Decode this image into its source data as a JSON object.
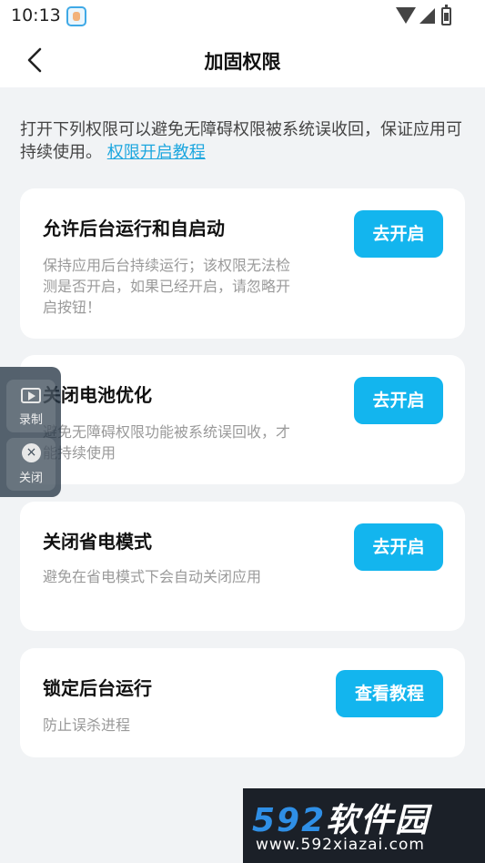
{
  "status_bar": {
    "time": "10:13",
    "icons": [
      "app-notification-icon",
      "wifi-icon",
      "signal-icon",
      "battery-icon"
    ]
  },
  "header": {
    "back_icon": "chevron-left-icon",
    "title": "加固权限"
  },
  "intro": {
    "text": "打开下列权限可以避免无障碍权限被系统误收回，保证应用可持续使用。",
    "link": "权限开启教程"
  },
  "cards": [
    {
      "title": "允许后台运行和自启动",
      "description": "保持应用后台持续运行；该权限无法检测是否开启，如果已经开启，请忽略开启按钮！",
      "button": "去开启"
    },
    {
      "title": "关闭电池优化",
      "description": "避免无障碍权限功能被系统误回收，才能持续使用",
      "button": "去开启"
    },
    {
      "title": "关闭省电模式",
      "description": "避免在省电模式下会自动关闭应用",
      "button": "去开启"
    },
    {
      "title": "锁定后台运行",
      "description": "防止误杀进程",
      "button": "查看教程"
    }
  ],
  "floating_panel": {
    "record_label": "录制",
    "close_label": "关闭",
    "close_glyph": "×"
  },
  "watermark": {
    "numbers": "592",
    "text": "软件园",
    "url": "www.592xiazai.com"
  },
  "colors": {
    "accent": "#13b5ee",
    "link": "#1da7df",
    "background": "#f1f3f5",
    "card": "#ffffff"
  }
}
